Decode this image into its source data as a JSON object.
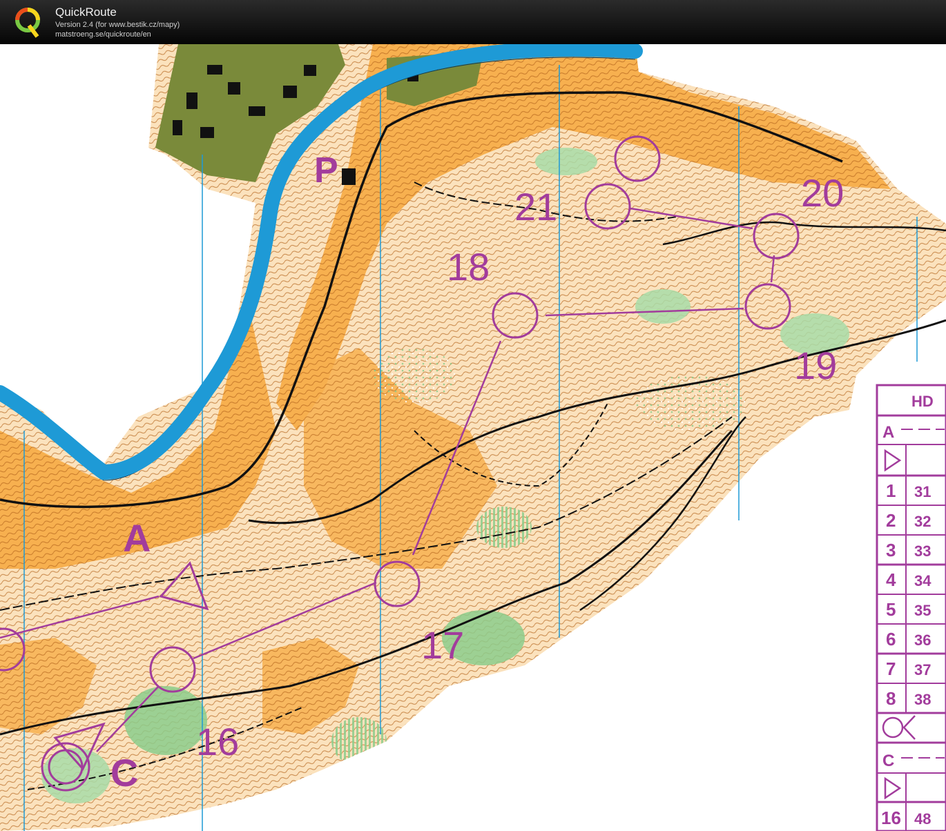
{
  "app": {
    "title": "QuickRoute",
    "version": "Version 2.4  (for www.bestik.cz/mapy)",
    "url": "matstroeng.se/quickroute/en",
    "logo_letter": "Q"
  },
  "colors": {
    "course": "#a23c9c",
    "open_land": "#f7b04f",
    "light_open": "#fbd9a6",
    "water": "#1e9ad6",
    "forest_green": "#8ccd8c",
    "contour": "#b5651d",
    "urban": "#7a8a3a"
  },
  "map": {
    "parking_symbol": "P",
    "control_labels": [
      {
        "id": "16",
        "text": "16"
      },
      {
        "id": "17",
        "text": "17"
      },
      {
        "id": "18",
        "text": "18"
      },
      {
        "id": "19",
        "text": "19"
      },
      {
        "id": "20",
        "text": "20"
      },
      {
        "id": "21",
        "text": "21"
      }
    ],
    "start_labels": [
      {
        "id": "A",
        "text": "A"
      },
      {
        "id": "C",
        "text": "C"
      }
    ]
  },
  "control_description": {
    "header": "HD",
    "course_a_label": "A",
    "course_c_label": "C",
    "rows": [
      {
        "num": "1",
        "code": "31"
      },
      {
        "num": "2",
        "code": "32"
      },
      {
        "num": "3",
        "code": "33"
      },
      {
        "num": "4",
        "code": "34"
      },
      {
        "num": "5",
        "code": "35"
      },
      {
        "num": "6",
        "code": "36"
      },
      {
        "num": "7",
        "code": "37"
      },
      {
        "num": "8",
        "code": "38"
      },
      {
        "num": "16",
        "code": "48"
      }
    ]
  }
}
